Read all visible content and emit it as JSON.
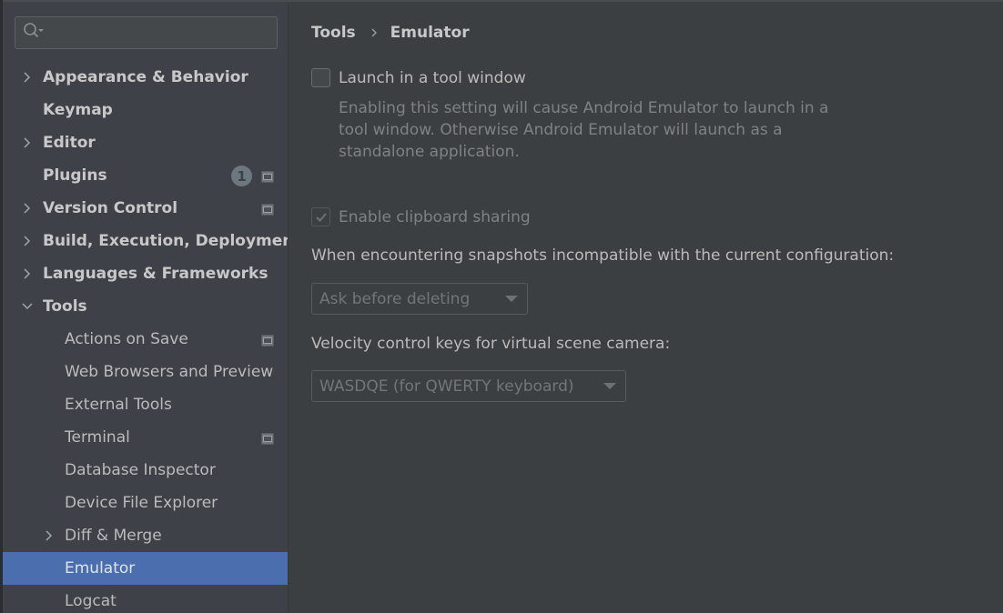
{
  "search": {
    "placeholder": "",
    "value": ""
  },
  "sidebar": {
    "items": [
      {
        "label": "Appearance & Behavior",
        "level": 0,
        "expandable": true,
        "expanded": false,
        "bold": true
      },
      {
        "label": "Keymap",
        "level": 0,
        "expandable": false,
        "bold": true
      },
      {
        "label": "Editor",
        "level": 0,
        "expandable": true,
        "expanded": false,
        "bold": true
      },
      {
        "label": "Plugins",
        "level": 0,
        "expandable": false,
        "bold": true,
        "badge": "1",
        "project_icon": true
      },
      {
        "label": "Version Control",
        "level": 0,
        "expandable": true,
        "expanded": false,
        "bold": true,
        "project_icon": true
      },
      {
        "label": "Build, Execution, Deployment",
        "level": 0,
        "expandable": true,
        "expanded": false,
        "bold": true
      },
      {
        "label": "Languages & Frameworks",
        "level": 0,
        "expandable": true,
        "expanded": false,
        "bold": true
      },
      {
        "label": "Tools",
        "level": 0,
        "expandable": true,
        "expanded": true,
        "bold": true
      },
      {
        "label": "Actions on Save",
        "level": 1,
        "expandable": false,
        "project_icon": true
      },
      {
        "label": "Web Browsers and Preview",
        "level": 1,
        "expandable": false
      },
      {
        "label": "External Tools",
        "level": 1,
        "expandable": false
      },
      {
        "label": "Terminal",
        "level": 1,
        "expandable": false,
        "project_icon": true
      },
      {
        "label": "Database Inspector",
        "level": 1,
        "expandable": false
      },
      {
        "label": "Device File Explorer",
        "level": 1,
        "expandable": false
      },
      {
        "label": "Diff & Merge",
        "level": 1,
        "expandable": true,
        "expanded": false
      },
      {
        "label": "Emulator",
        "level": 1,
        "expandable": false,
        "selected": true
      },
      {
        "label": "Logcat",
        "level": 1,
        "expandable": false
      }
    ]
  },
  "breadcrumb": {
    "parent": "Tools",
    "current": "Emulator"
  },
  "settings": {
    "launch_in_tool_window": {
      "label": "Launch in a tool window",
      "checked": false,
      "description": "Enabling this setting will cause Android Emulator to launch in a tool window. Otherwise Android Emulator will launch as a standalone application."
    },
    "clipboard_sharing": {
      "label": "Enable clipboard sharing",
      "checked": true,
      "disabled": true
    },
    "snapshots": {
      "label": "When encountering snapshots incompatible with the current configuration:",
      "selected": "Ask before deleting"
    },
    "velocity_keys": {
      "label": "Velocity control keys for virtual scene camera:",
      "selected": "WASDQE (for QWERTY keyboard)"
    }
  },
  "colors": {
    "sidebar_bg": "#3e4148",
    "content_bg": "#3c3f41",
    "selection": "#4b6eaf",
    "text": "#bbbbbb",
    "disabled_text": "#7f8285"
  }
}
